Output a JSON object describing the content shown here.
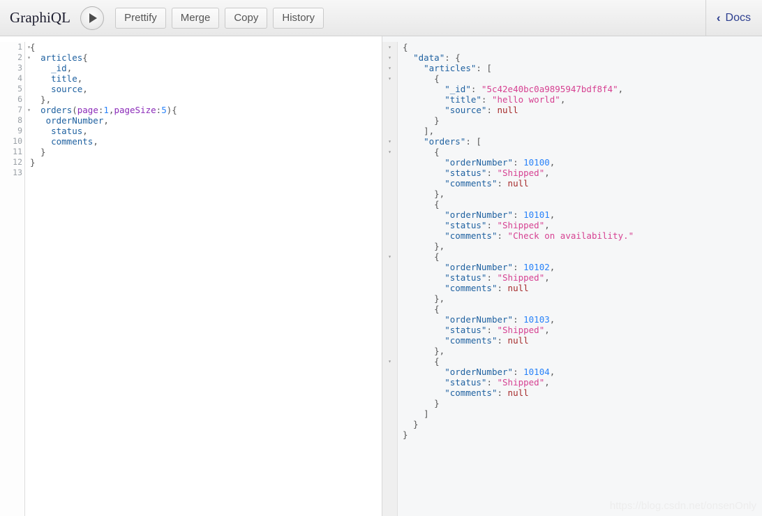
{
  "app": {
    "title": "GraphiQL",
    "watermark": "https://blog.csdn.net/onsenOnly"
  },
  "toolbar": {
    "execute_label": "",
    "execute_icon": "play-triangle-icon",
    "buttons": [
      {
        "label": "Prettify"
      },
      {
        "label": "Merge"
      },
      {
        "label": "Copy"
      },
      {
        "label": "History"
      }
    ],
    "docs": {
      "label": "Docs",
      "chevron": "‹",
      "icon": "chevron-left-icon"
    }
  },
  "query_editor": {
    "line_numbers": [
      "1",
      "2",
      "3",
      "4",
      "5",
      "6",
      "7",
      "8",
      "9",
      "10",
      "11",
      "12",
      "13"
    ],
    "fold_lines": [
      1,
      2,
      7
    ],
    "fold_glyph": "▾",
    "lines": [
      [
        {
          "t": "{",
          "c": "q-punct"
        }
      ],
      [
        {
          "t": "  ",
          "c": "q-punct"
        },
        {
          "t": "articles",
          "c": "q-field"
        },
        {
          "t": "{",
          "c": "q-punct"
        }
      ],
      [
        {
          "t": "    ",
          "c": "q-punct"
        },
        {
          "t": "_id",
          "c": "q-field"
        },
        {
          "t": ",",
          "c": "q-punct"
        }
      ],
      [
        {
          "t": "    ",
          "c": "q-punct"
        },
        {
          "t": "title",
          "c": "q-field"
        },
        {
          "t": ",",
          "c": "q-punct"
        }
      ],
      [
        {
          "t": "    ",
          "c": "q-punct"
        },
        {
          "t": "source",
          "c": "q-field"
        },
        {
          "t": ",",
          "c": "q-punct"
        }
      ],
      [
        {
          "t": "  },",
          "c": "q-punct"
        }
      ],
      [
        {
          "t": "  ",
          "c": "q-punct"
        },
        {
          "t": "orders",
          "c": "q-field"
        },
        {
          "t": "(",
          "c": "q-punct"
        },
        {
          "t": "page",
          "c": "q-arg"
        },
        {
          "t": ":",
          "c": "q-punct"
        },
        {
          "t": "1",
          "c": "q-num"
        },
        {
          "t": ",",
          "c": "q-punct"
        },
        {
          "t": "pageSize",
          "c": "q-arg"
        },
        {
          "t": ":",
          "c": "q-punct"
        },
        {
          "t": "5",
          "c": "q-num"
        },
        {
          "t": "){",
          "c": "q-punct"
        }
      ],
      [
        {
          "t": "   ",
          "c": "q-punct"
        },
        {
          "t": "orderNumber",
          "c": "q-field"
        },
        {
          "t": ",",
          "c": "q-punct"
        }
      ],
      [
        {
          "t": "    ",
          "c": "q-punct"
        },
        {
          "t": "status",
          "c": "q-field"
        },
        {
          "t": ",",
          "c": "q-punct"
        }
      ],
      [
        {
          "t": "    ",
          "c": "q-punct"
        },
        {
          "t": "comments",
          "c": "q-field"
        },
        {
          "t": ",",
          "c": "q-punct"
        }
      ],
      [
        {
          "t": "  }",
          "c": "q-punct"
        }
      ],
      [
        {
          "t": "}",
          "c": "q-punct"
        }
      ],
      []
    ],
    "plain_text": "{\n  articles{\n    _id,\n    title,\n    source,\n  },\n  orders(page:1,pageSize:5){\n   orderNumber,\n    status,\n    comments,\n  }\n}\n"
  },
  "result_viewer": {
    "fold_glyph": "▾",
    "fold_lines": [
      1,
      2,
      3,
      4,
      10,
      11,
      21,
      31,
      41
    ],
    "lines": [
      [
        {
          "t": "{",
          "c": "j-punct"
        }
      ],
      [
        {
          "t": "  ",
          "c": "j-punct"
        },
        {
          "t": "\"data\"",
          "c": "j-key"
        },
        {
          "t": ": {",
          "c": "j-punct"
        }
      ],
      [
        {
          "t": "    ",
          "c": "j-punct"
        },
        {
          "t": "\"articles\"",
          "c": "j-key"
        },
        {
          "t": ": [",
          "c": "j-punct"
        }
      ],
      [
        {
          "t": "      {",
          "c": "j-punct"
        }
      ],
      [
        {
          "t": "        ",
          "c": "j-punct"
        },
        {
          "t": "\"_id\"",
          "c": "j-key"
        },
        {
          "t": ": ",
          "c": "j-punct"
        },
        {
          "t": "\"5c42e40bc0a9895947bdf8f4\"",
          "c": "j-str"
        },
        {
          "t": ",",
          "c": "j-punct"
        }
      ],
      [
        {
          "t": "        ",
          "c": "j-punct"
        },
        {
          "t": "\"title\"",
          "c": "j-key"
        },
        {
          "t": ": ",
          "c": "j-punct"
        },
        {
          "t": "\"hello world\"",
          "c": "j-str"
        },
        {
          "t": ",",
          "c": "j-punct"
        }
      ],
      [
        {
          "t": "        ",
          "c": "j-punct"
        },
        {
          "t": "\"source\"",
          "c": "j-key"
        },
        {
          "t": ": ",
          "c": "j-punct"
        },
        {
          "t": "null",
          "c": "j-null"
        }
      ],
      [
        {
          "t": "      }",
          "c": "j-punct"
        }
      ],
      [
        {
          "t": "    ],",
          "c": "j-punct"
        }
      ],
      [
        {
          "t": "    ",
          "c": "j-punct"
        },
        {
          "t": "\"orders\"",
          "c": "j-key"
        },
        {
          "t": ": [",
          "c": "j-punct"
        }
      ],
      [
        {
          "t": "      {",
          "c": "j-punct"
        }
      ],
      [
        {
          "t": "        ",
          "c": "j-punct"
        },
        {
          "t": "\"orderNumber\"",
          "c": "j-key"
        },
        {
          "t": ": ",
          "c": "j-punct"
        },
        {
          "t": "10100",
          "c": "j-num"
        },
        {
          "t": ",",
          "c": "j-punct"
        }
      ],
      [
        {
          "t": "        ",
          "c": "j-punct"
        },
        {
          "t": "\"status\"",
          "c": "j-key"
        },
        {
          "t": ": ",
          "c": "j-punct"
        },
        {
          "t": "\"Shipped\"",
          "c": "j-str"
        },
        {
          "t": ",",
          "c": "j-punct"
        }
      ],
      [
        {
          "t": "        ",
          "c": "j-punct"
        },
        {
          "t": "\"comments\"",
          "c": "j-key"
        },
        {
          "t": ": ",
          "c": "j-punct"
        },
        {
          "t": "null",
          "c": "j-null"
        }
      ],
      [
        {
          "t": "      },",
          "c": "j-punct"
        }
      ],
      [
        {
          "t": "      {",
          "c": "j-punct"
        }
      ],
      [
        {
          "t": "        ",
          "c": "j-punct"
        },
        {
          "t": "\"orderNumber\"",
          "c": "j-key"
        },
        {
          "t": ": ",
          "c": "j-punct"
        },
        {
          "t": "10101",
          "c": "j-num"
        },
        {
          "t": ",",
          "c": "j-punct"
        }
      ],
      [
        {
          "t": "        ",
          "c": "j-punct"
        },
        {
          "t": "\"status\"",
          "c": "j-key"
        },
        {
          "t": ": ",
          "c": "j-punct"
        },
        {
          "t": "\"Shipped\"",
          "c": "j-str"
        },
        {
          "t": ",",
          "c": "j-punct"
        }
      ],
      [
        {
          "t": "        ",
          "c": "j-punct"
        },
        {
          "t": "\"comments\"",
          "c": "j-key"
        },
        {
          "t": ": ",
          "c": "j-punct"
        },
        {
          "t": "\"Check on availability.\"",
          "c": "j-str"
        }
      ],
      [
        {
          "t": "      },",
          "c": "j-punct"
        }
      ],
      [
        {
          "t": "      {",
          "c": "j-punct"
        }
      ],
      [
        {
          "t": "        ",
          "c": "j-punct"
        },
        {
          "t": "\"orderNumber\"",
          "c": "j-key"
        },
        {
          "t": ": ",
          "c": "j-punct"
        },
        {
          "t": "10102",
          "c": "j-num"
        },
        {
          "t": ",",
          "c": "j-punct"
        }
      ],
      [
        {
          "t": "        ",
          "c": "j-punct"
        },
        {
          "t": "\"status\"",
          "c": "j-key"
        },
        {
          "t": ": ",
          "c": "j-punct"
        },
        {
          "t": "\"Shipped\"",
          "c": "j-str"
        },
        {
          "t": ",",
          "c": "j-punct"
        }
      ],
      [
        {
          "t": "        ",
          "c": "j-punct"
        },
        {
          "t": "\"comments\"",
          "c": "j-key"
        },
        {
          "t": ": ",
          "c": "j-punct"
        },
        {
          "t": "null",
          "c": "j-null"
        }
      ],
      [
        {
          "t": "      },",
          "c": "j-punct"
        }
      ],
      [
        {
          "t": "      {",
          "c": "j-punct"
        }
      ],
      [
        {
          "t": "        ",
          "c": "j-punct"
        },
        {
          "t": "\"orderNumber\"",
          "c": "j-key"
        },
        {
          "t": ": ",
          "c": "j-punct"
        },
        {
          "t": "10103",
          "c": "j-num"
        },
        {
          "t": ",",
          "c": "j-punct"
        }
      ],
      [
        {
          "t": "        ",
          "c": "j-punct"
        },
        {
          "t": "\"status\"",
          "c": "j-key"
        },
        {
          "t": ": ",
          "c": "j-punct"
        },
        {
          "t": "\"Shipped\"",
          "c": "j-str"
        },
        {
          "t": ",",
          "c": "j-punct"
        }
      ],
      [
        {
          "t": "        ",
          "c": "j-punct"
        },
        {
          "t": "\"comments\"",
          "c": "j-key"
        },
        {
          "t": ": ",
          "c": "j-punct"
        },
        {
          "t": "null",
          "c": "j-null"
        }
      ],
      [
        {
          "t": "      },",
          "c": "j-punct"
        }
      ],
      [
        {
          "t": "      {",
          "c": "j-punct"
        }
      ],
      [
        {
          "t": "        ",
          "c": "j-punct"
        },
        {
          "t": "\"orderNumber\"",
          "c": "j-key"
        },
        {
          "t": ": ",
          "c": "j-punct"
        },
        {
          "t": "10104",
          "c": "j-num"
        },
        {
          "t": ",",
          "c": "j-punct"
        }
      ],
      [
        {
          "t": "        ",
          "c": "j-punct"
        },
        {
          "t": "\"status\"",
          "c": "j-key"
        },
        {
          "t": ": ",
          "c": "j-punct"
        },
        {
          "t": "\"Shipped\"",
          "c": "j-str"
        },
        {
          "t": ",",
          "c": "j-punct"
        }
      ],
      [
        {
          "t": "        ",
          "c": "j-punct"
        },
        {
          "t": "\"comments\"",
          "c": "j-key"
        },
        {
          "t": ": ",
          "c": "j-punct"
        },
        {
          "t": "null",
          "c": "j-null"
        }
      ],
      [
        {
          "t": "      }",
          "c": "j-punct"
        }
      ],
      [
        {
          "t": "    ]",
          "c": "j-punct"
        }
      ],
      [
        {
          "t": "  }",
          "c": "j-punct"
        }
      ],
      [
        {
          "t": "}",
          "c": "j-punct"
        }
      ]
    ],
    "data": {
      "data": {
        "articles": [
          {
            "_id": "5c42e40bc0a9895947bdf8f4",
            "title": "hello world",
            "source": null
          }
        ],
        "orders": [
          {
            "orderNumber": 10100,
            "status": "Shipped",
            "comments": null
          },
          {
            "orderNumber": 10101,
            "status": "Shipped",
            "comments": "Check on availability."
          },
          {
            "orderNumber": 10102,
            "status": "Shipped",
            "comments": null
          },
          {
            "orderNumber": 10103,
            "status": "Shipped",
            "comments": null
          },
          {
            "orderNumber": 10104,
            "status": "Shipped",
            "comments": null
          }
        ]
      }
    }
  },
  "colors": {
    "toolbar_top": "#f7f7f7",
    "toolbar_bottom": "#e8e8e8",
    "accent_docs": "#2c3e8f",
    "json_key": "#1f61a0",
    "json_string": "#d64292",
    "json_number": "#2882f9",
    "json_null": "#a52a2a",
    "query_arg": "#8b2bb9",
    "result_bg": "#f6f7f8",
    "editor_bg": "#ffffff"
  }
}
